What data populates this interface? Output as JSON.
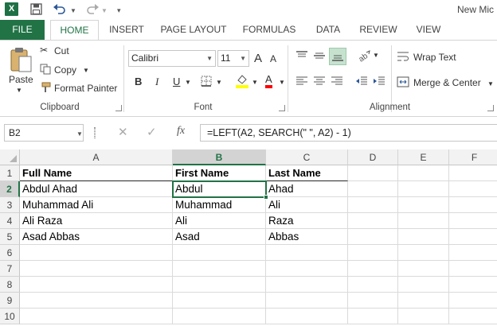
{
  "app": {
    "logo": "X",
    "title": "New Mic"
  },
  "quick_access": {
    "save_icon": "save-icon",
    "undo_icon": "undo-icon",
    "redo_icon": "redo-icon"
  },
  "tabs": [
    "FILE",
    "HOME",
    "INSERT",
    "PAGE LAYOUT",
    "FORMULAS",
    "DATA",
    "REVIEW",
    "VIEW"
  ],
  "clipboard": {
    "paste": "Paste",
    "cut": "Cut",
    "copy": "Copy",
    "format_painter": "Format Painter",
    "label": "Clipboard"
  },
  "font": {
    "name": "Calibri",
    "size": "11",
    "label": "Font",
    "bold": "B",
    "italic": "I",
    "underline": "U",
    "grow": "A",
    "shrink": "A",
    "font_color": "A",
    "fill_color": "#ffff00",
    "text_color": "#ff0000"
  },
  "alignment": {
    "wrap": "Wrap Text",
    "merge": "Merge & Center",
    "label": "Alignment"
  },
  "formula_bar": {
    "name_box": "B2",
    "fx": "fx",
    "formula": "=LEFT(A2, SEARCH(\" \", A2) - 1)"
  },
  "sheet": {
    "columns": [
      "A",
      "B",
      "C",
      "D",
      "E",
      "F"
    ],
    "rows": [
      "1",
      "2",
      "3",
      "4",
      "5",
      "6",
      "7",
      "8",
      "9",
      "10"
    ],
    "selected_cell": "B2",
    "cells": [
      [
        "Full Name",
        "First Name",
        "Last Name"
      ],
      [
        "Abdul Ahad",
        "Abdul",
        "Ahad"
      ],
      [
        "Muhammad Ali",
        "Muhammad",
        "Ali"
      ],
      [
        "Ali Raza",
        "Ali",
        "Raza"
      ],
      [
        "Asad Abbas",
        "Asad",
        "Abbas"
      ]
    ]
  },
  "colors": {
    "accent": "#217346"
  }
}
